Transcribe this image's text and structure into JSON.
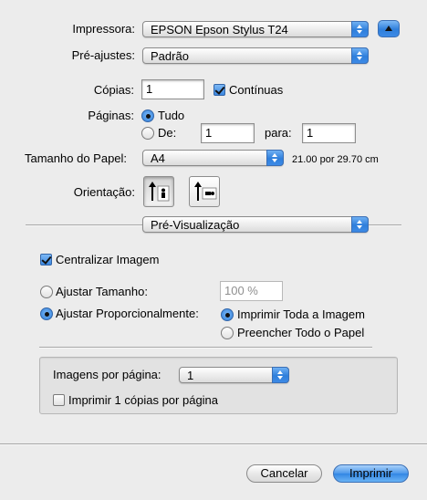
{
  "printer": {
    "label": "Impressora:",
    "value": "EPSON Epson Stylus T24"
  },
  "presets": {
    "label": "Pré-ajustes:",
    "value": "Padrão"
  },
  "copies": {
    "label": "Cópias:",
    "value": "1",
    "collated_label": "Contínuas",
    "collated": true
  },
  "pages": {
    "label": "Páginas:",
    "all_label": "Tudo",
    "from_label": "De:",
    "from_value": "1",
    "to_label": "para:",
    "to_value": "1",
    "selected": "all"
  },
  "paper_size": {
    "label": "Tamanho do Papel:",
    "value": "A4",
    "dimensions": "21.00 por 29.70 cm"
  },
  "orientation": {
    "label": "Orientação:",
    "selected": "portrait"
  },
  "panel": {
    "value": "Pré-Visualização"
  },
  "center_image": {
    "label": "Centralizar Imagem",
    "checked": true
  },
  "scale": {
    "label": "Ajustar Tamanho:",
    "value": "100 %"
  },
  "scale_to_fit": {
    "label": "Ajustar Proporcionalmente:",
    "print_entire_label": "Imprimir Toda a Imagem",
    "fill_paper_label": "Preencher Todo o Papel",
    "selected": "print_entire"
  },
  "images_per_page": {
    "label": "Imagens por página:",
    "value": "1"
  },
  "print_copies_per_page": {
    "label": "Imprimir 1 cópias por página",
    "checked": false
  },
  "buttons": {
    "cancel": "Cancelar",
    "print": "Imprimir"
  }
}
